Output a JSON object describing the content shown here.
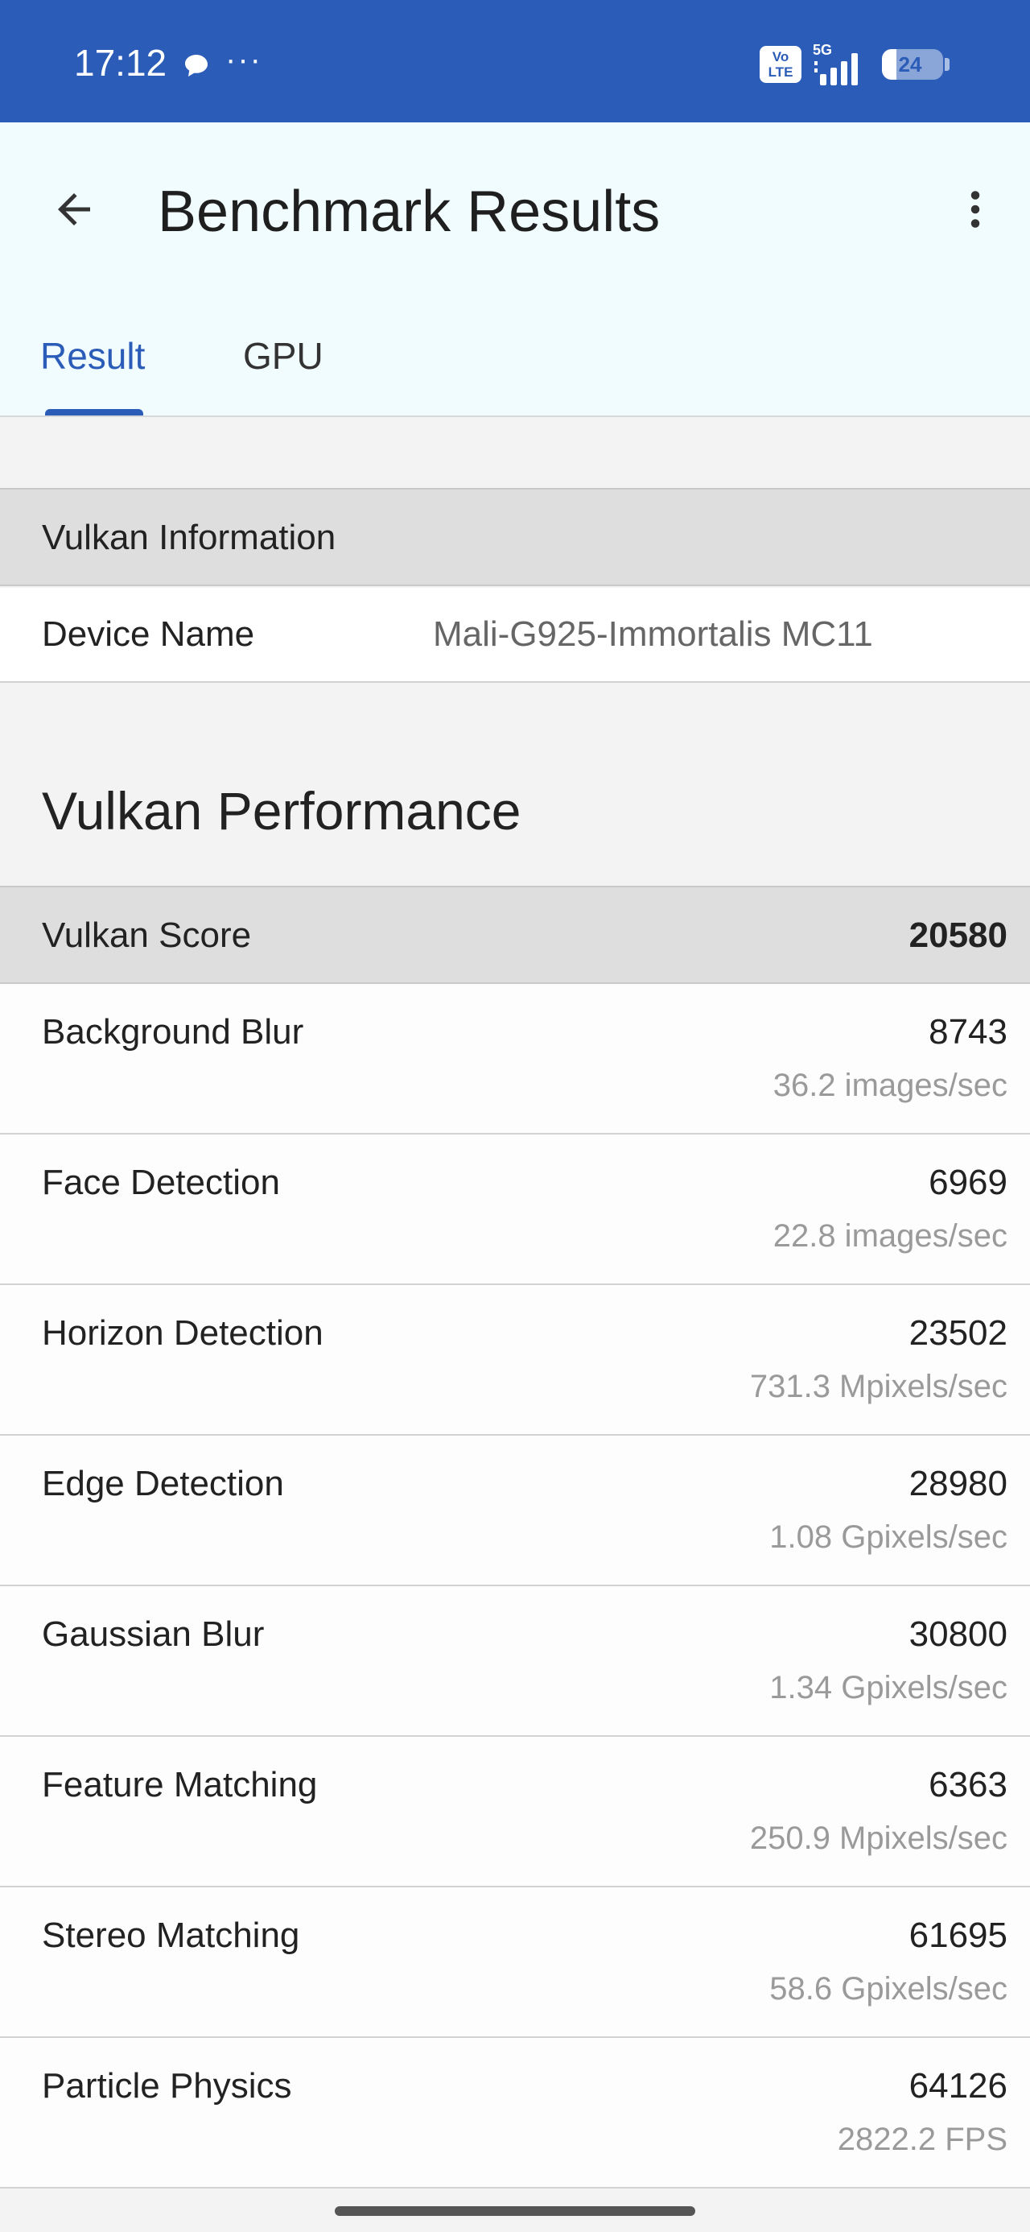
{
  "status_bar": {
    "time": "17:12",
    "dots": "···",
    "volte_line1": "Vo",
    "volte_line2": "LTE",
    "network": "5G",
    "battery": "24",
    "battery_level": 0.24,
    "background": "#2a5cb8"
  },
  "app_bar": {
    "title": "Benchmark Results",
    "back_icon": "arrow-left-icon",
    "menu_icon": "more-vert-icon"
  },
  "tabs": [
    {
      "label": "Result",
      "selected": true
    },
    {
      "label": "GPU",
      "selected": false
    }
  ],
  "vulkan_info": {
    "header": "Vulkan Information",
    "device_label": "Device Name",
    "device_value": "Mali-G925-Immortalis MC11"
  },
  "performance": {
    "title": "Vulkan Performance",
    "score_label": "Vulkan Score",
    "score_value": "20580",
    "rows": [
      {
        "name": "Background Blur",
        "score": "8743",
        "rate": "36.2 images/sec"
      },
      {
        "name": "Face Detection",
        "score": "6969",
        "rate": "22.8 images/sec"
      },
      {
        "name": "Horizon Detection",
        "score": "23502",
        "rate": "731.3 Mpixels/sec"
      },
      {
        "name": "Edge Detection",
        "score": "28980",
        "rate": "1.08 Gpixels/sec"
      },
      {
        "name": "Gaussian Blur",
        "score": "30800",
        "rate": "1.34 Gpixels/sec"
      },
      {
        "name": "Feature Matching",
        "score": "6363",
        "rate": "250.9 Mpixels/sec"
      },
      {
        "name": "Stereo Matching",
        "score": "61695",
        "rate": "58.6 Gpixels/sec"
      },
      {
        "name": "Particle Physics",
        "score": "64126",
        "rate": "2822.2 FPS"
      }
    ]
  },
  "colors": {
    "accent": "#2a5cb8",
    "app_bar_bg": "#f1fcff",
    "header_row_bg": "#dedede",
    "secondary_text": "#9a9a9a"
  }
}
